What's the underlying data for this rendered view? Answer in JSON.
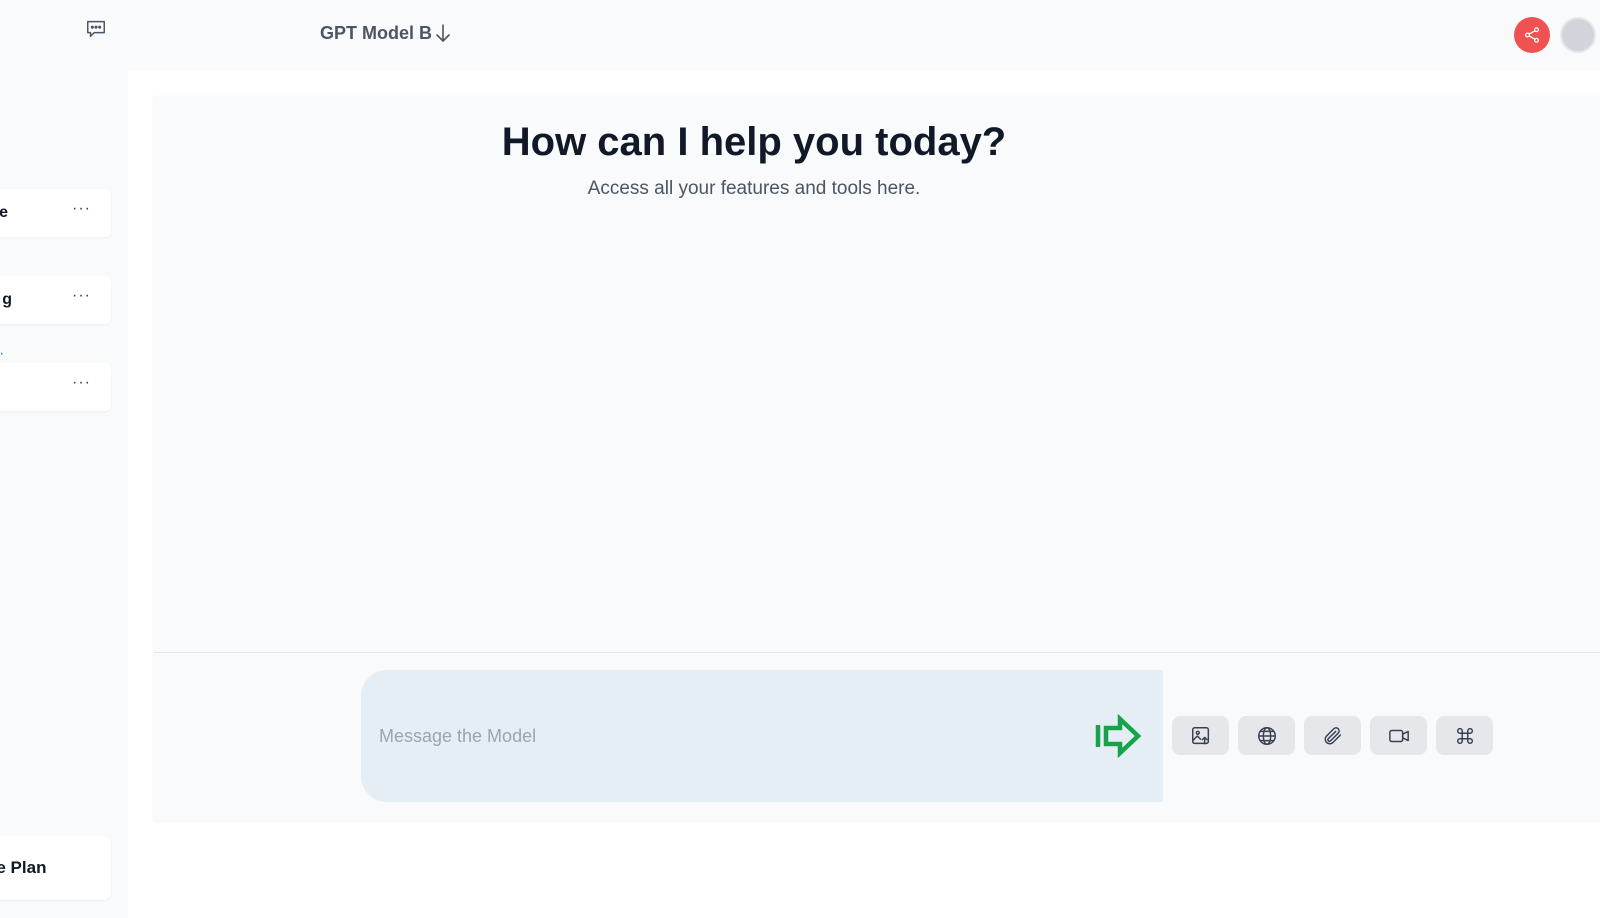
{
  "sidebar": {
    "items": [
      {
        "label": "e",
        "menu": "···"
      },
      {
        "label": "g",
        "menu": "···"
      },
      {
        "label": "",
        "menu": "···"
      }
    ],
    "link_fragment": ",",
    "upgrade_label": "de Plan"
  },
  "header": {
    "model_name": "GPT Model B"
  },
  "main": {
    "title": "How can I help you today?",
    "subtitle": "Access all your features and tools here."
  },
  "composer": {
    "placeholder": "Message the Model",
    "value": ""
  },
  "colors": {
    "accent_send": "#16a34a",
    "share_button": "#f05252"
  },
  "icons": {
    "new_chat": "chat-bubble-icon",
    "share": "share-icon",
    "send": "send-arrow-icon",
    "tools": [
      "image-upload-icon",
      "globe-icon",
      "paperclip-icon",
      "video-camera-icon",
      "command-icon"
    ]
  }
}
